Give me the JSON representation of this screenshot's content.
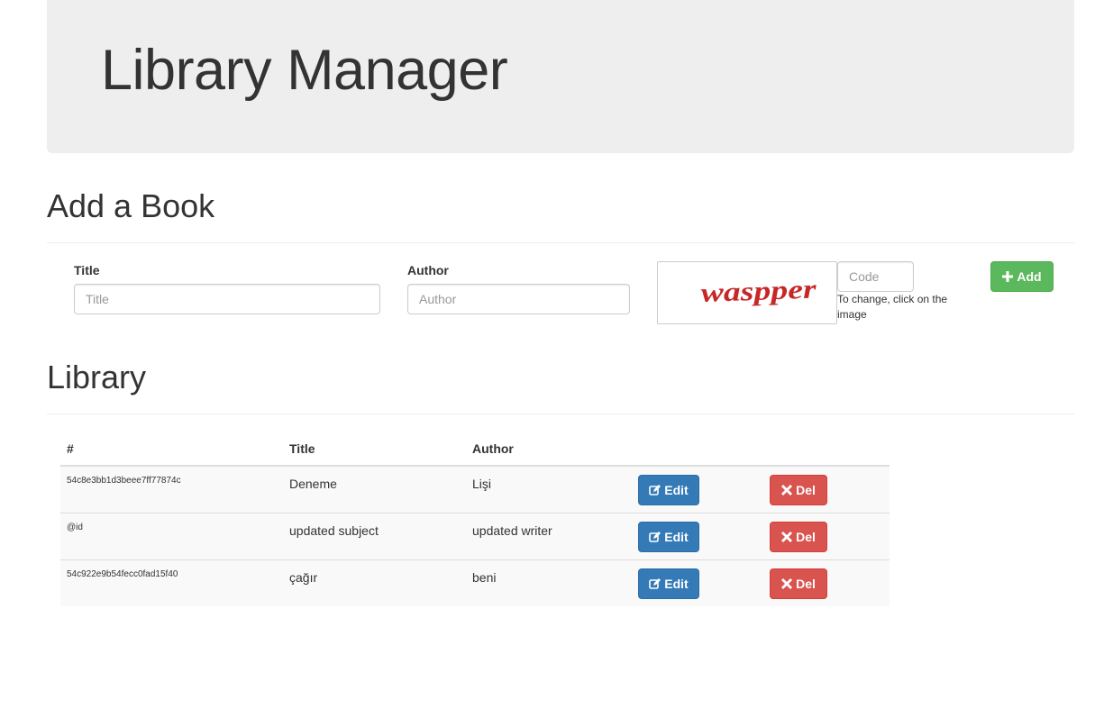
{
  "header": {
    "title": "Library Manager"
  },
  "add_book": {
    "heading": "Add a Book",
    "title_label": "Title",
    "title_placeholder": "Title",
    "title_value": "",
    "author_label": "Author",
    "author_placeholder": "Author",
    "author_value": "",
    "captcha_text": "waspper",
    "code_placeholder": "Code",
    "code_value": "",
    "captcha_help": "To change, click on the image",
    "add_button_label": "Add"
  },
  "library": {
    "heading": "Library",
    "columns": [
      "#",
      "Title",
      "Author"
    ],
    "edit_label": "Edit",
    "delete_label": "Del",
    "rows": [
      {
        "id": "54c8e3bb1d3beee7ff77874c",
        "title": "Deneme",
        "author": "Lişi"
      },
      {
        "id": "@id",
        "title": "updated subject",
        "author": "updated writer"
      },
      {
        "id": "54c922e9b54fecc0fad15f40",
        "title": "çağır",
        "author": "beni"
      }
    ]
  },
  "colors": {
    "jumbotron_bg": "#eeeeee",
    "success": "#5cb85c",
    "primary": "#337ab7",
    "danger": "#d9534f",
    "captcha_text": "#c62828"
  }
}
